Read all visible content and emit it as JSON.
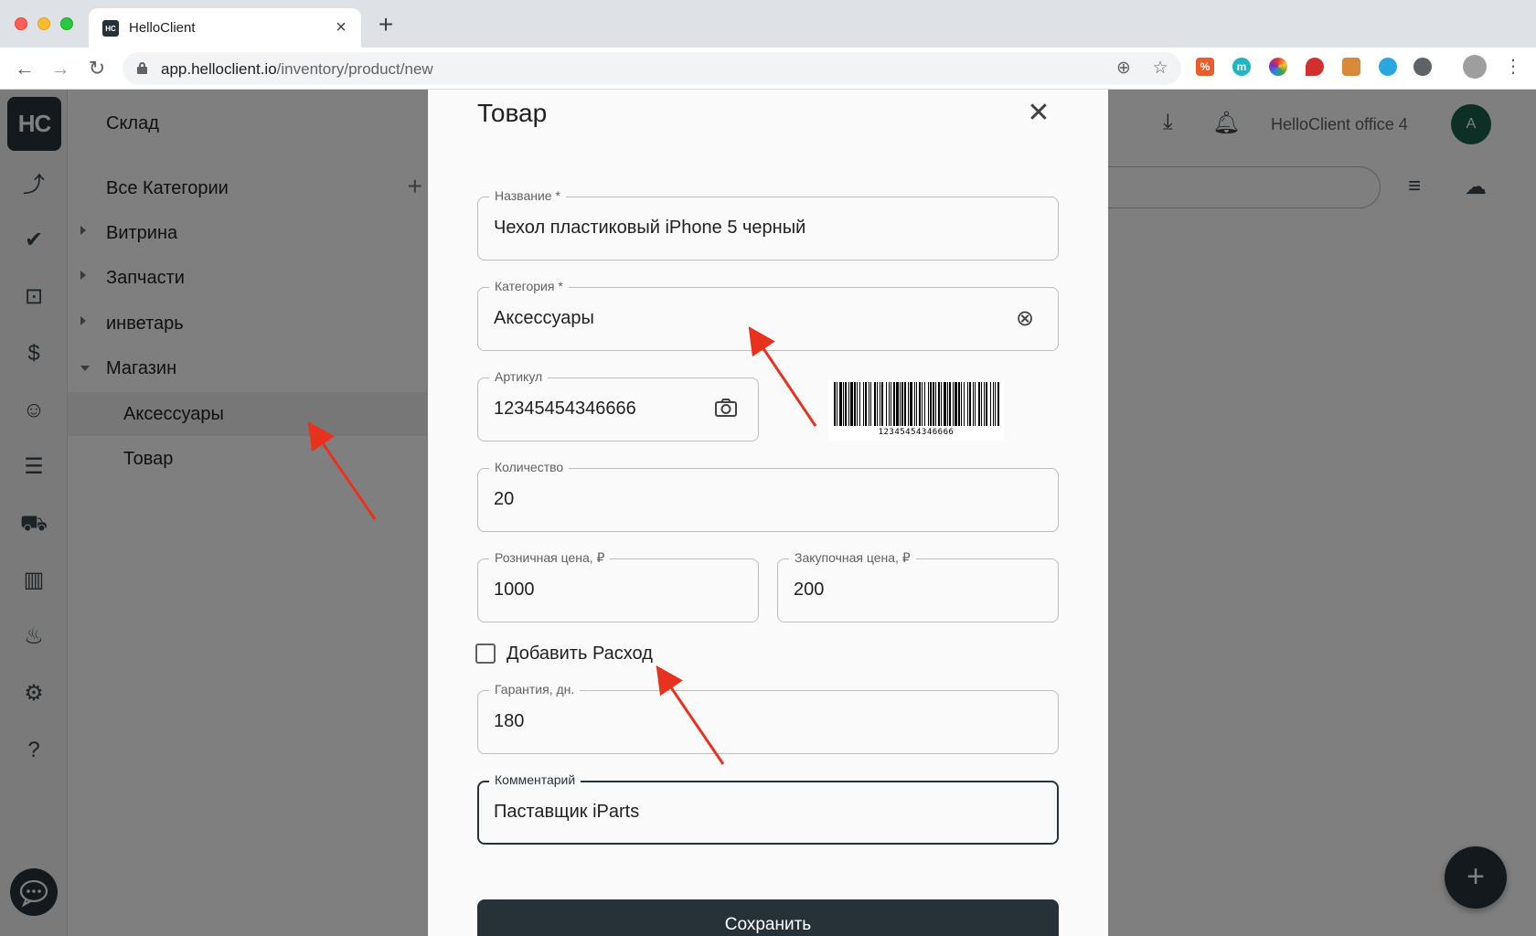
{
  "browser": {
    "tab_title": "HelloClient",
    "tab_favicon_text": "HC",
    "url_host": "app.helloclient.io",
    "url_path": "/inventory/product/new"
  },
  "rail": {
    "logo_text": "HC",
    "icons": [
      "trend-icon",
      "check-circle-icon",
      "inbox-icon",
      "dollar-icon",
      "people-icon",
      "table-icon",
      "cart-icon",
      "bar-chart-icon",
      "fire-icon",
      "gear-icon",
      "help-icon"
    ]
  },
  "categories": {
    "title": "Склад",
    "all_label": "Все Категории",
    "items": [
      {
        "label": "Витрина"
      },
      {
        "label": "Запчасти"
      },
      {
        "label": "инветарь"
      },
      {
        "label": "Магазин"
      }
    ],
    "sub_items": [
      {
        "label": "Аксессуары"
      },
      {
        "label": "Товар"
      }
    ]
  },
  "header": {
    "office": "HelloClient office 4",
    "avatar_letter": "A"
  },
  "dialog": {
    "title": "Товар",
    "name": {
      "label": "Название *",
      "value": "Чехол пластиковый iPhone 5 черный"
    },
    "category": {
      "label": "Категория *",
      "value": "Аксессуары"
    },
    "sku": {
      "label": "Артикул",
      "value": "12345454346666"
    },
    "barcode_text": "12345454346666",
    "quantity": {
      "label": "Количество",
      "value": "20"
    },
    "retail_price": {
      "label": "Розничная цена, ₽",
      "value": "1000"
    },
    "purchase_price": {
      "label": "Закупочная цена, ₽",
      "value": "200"
    },
    "add_expense_label": "Добавить Расход",
    "warranty": {
      "label": "Гарантия, дн.",
      "value": "180"
    },
    "comment": {
      "label": "Комментарий",
      "value": "Паставщик iParts"
    },
    "save_label": "Сохранить"
  },
  "colors": {
    "primary": "#263238",
    "annotation_arrow": "#e8321e"
  }
}
